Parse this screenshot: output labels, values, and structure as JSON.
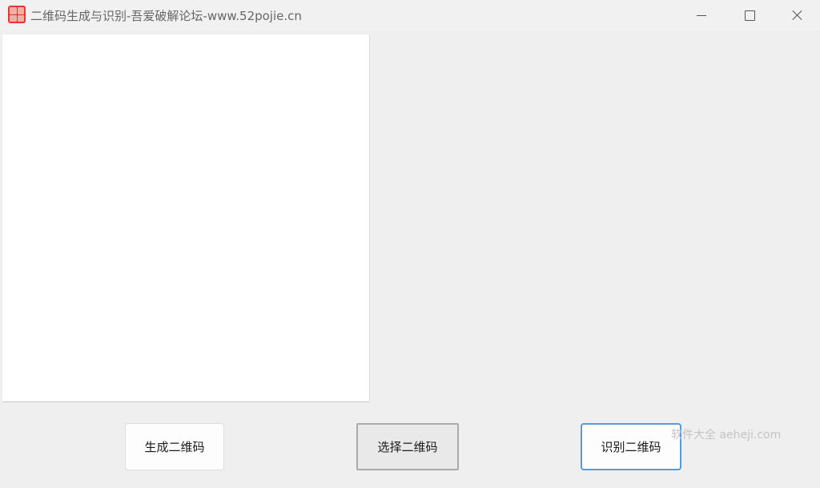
{
  "window": {
    "title": "二维码生成与识别-吾爱破解论坛-www.52pojie.cn",
    "icon": "app-logo-icon",
    "controls": [
      "minimize-icon",
      "maximize-icon",
      "close-icon"
    ]
  },
  "qr_panel": {
    "content": ""
  },
  "buttons": {
    "generate_label": "生成二维码",
    "select_label": "选择二维码",
    "recognize_label": "识别二维码"
  },
  "watermark": {
    "text": "软件大全 aeheji.com"
  },
  "colors": {
    "background": "#efefef",
    "panel": "#ffffff",
    "focus_border": "#5b9bd5",
    "icon_red": "#e0392f"
  }
}
